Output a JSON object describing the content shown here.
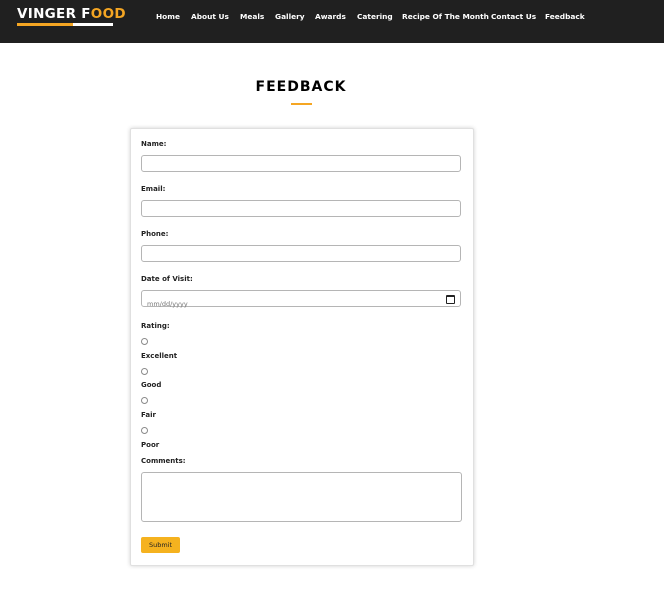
{
  "brand": {
    "name_part1": "VINGER F",
    "name_o": "O",
    "name_part2": "OD",
    "accent_color": "#f5a623"
  },
  "nav": [
    {
      "label": "Home"
    },
    {
      "label": "About Us"
    },
    {
      "label": "Meals"
    },
    {
      "label": "Gallery"
    },
    {
      "label": "Awards"
    },
    {
      "label": "Catering"
    },
    {
      "label": "Recipe Of The Month"
    },
    {
      "label": "Contact Us"
    },
    {
      "label": "Feedback"
    }
  ],
  "page": {
    "title": "FEEDBACK"
  },
  "form": {
    "name_label": "Name:",
    "name_value": "",
    "email_label": "Email:",
    "email_value": "",
    "phone_label": "Phone:",
    "phone_value": "",
    "date_label": "Date of Visit:",
    "date_placeholder": "mm/dd/yyyy",
    "rating_label": "Rating:",
    "rating_options": [
      {
        "label": "Excellent",
        "selected": false
      },
      {
        "label": "Good",
        "selected": false
      },
      {
        "label": "Fair",
        "selected": false
      },
      {
        "label": "Poor",
        "selected": false
      }
    ],
    "comments_label": "Comments:",
    "comments_value": "",
    "submit_label": "Submit"
  }
}
